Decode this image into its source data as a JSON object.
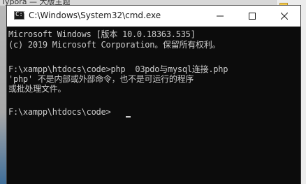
{
  "background": {
    "top_strip_text": "Typora — 大版主题"
  },
  "window": {
    "title": "C:\\Windows\\System32\\cmd.exe",
    "app_icon_glyph": "C:\\",
    "controls": {
      "minimize": "minimize",
      "maximize": "maximize",
      "close": "close"
    }
  },
  "console": {
    "lines": [
      "Microsoft Windows [版本 10.0.18363.535]",
      "(c) 2019 Microsoft Corporation。保留所有权利。",
      "",
      "F:\\xampp\\htdocs\\code>php  03pdo与mysql连接.php",
      "'php' 不是内部或外部命令，也不是可运行的程序",
      "或批处理文件。",
      "",
      "F:\\xampp\\htdocs\\code>"
    ]
  },
  "colors": {
    "console_bg": "#0c0c0c",
    "console_fg": "#cccccc",
    "titlebar_bg": "#ffffff",
    "desktop": "#4a7ba8"
  }
}
